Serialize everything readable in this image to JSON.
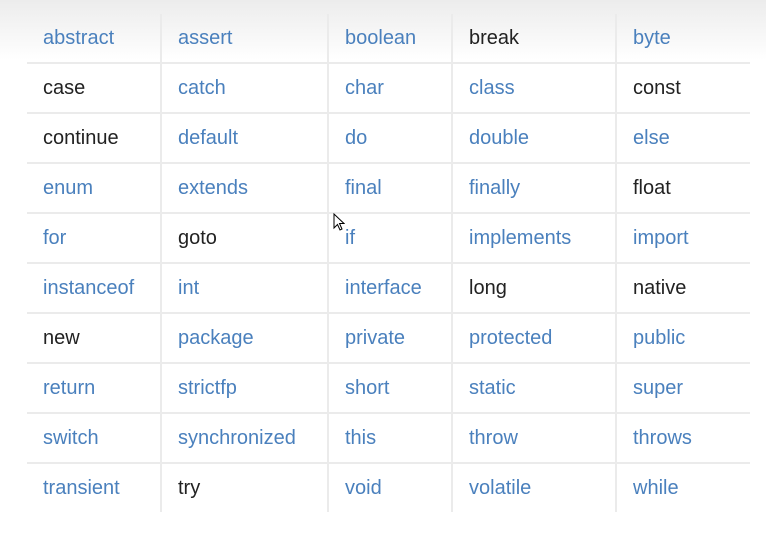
{
  "table": {
    "rows": [
      [
        {
          "t": "abstract",
          "link": true
        },
        {
          "t": "assert",
          "link": true
        },
        {
          "t": "boolean",
          "link": true
        },
        {
          "t": "break",
          "link": false
        },
        {
          "t": "byte",
          "link": true
        }
      ],
      [
        {
          "t": "case",
          "link": false
        },
        {
          "t": "catch",
          "link": true
        },
        {
          "t": "char",
          "link": true
        },
        {
          "t": "class",
          "link": true
        },
        {
          "t": "const",
          "link": false
        }
      ],
      [
        {
          "t": "continue",
          "link": false
        },
        {
          "t": "default",
          "link": true
        },
        {
          "t": "do",
          "link": true
        },
        {
          "t": "double",
          "link": true
        },
        {
          "t": "else",
          "link": true
        }
      ],
      [
        {
          "t": "enum",
          "link": true
        },
        {
          "t": "extends",
          "link": true
        },
        {
          "t": "final",
          "link": true
        },
        {
          "t": "finally",
          "link": true
        },
        {
          "t": "float",
          "link": false
        }
      ],
      [
        {
          "t": "for",
          "link": true
        },
        {
          "t": "goto",
          "link": false
        },
        {
          "t": "if",
          "link": true
        },
        {
          "t": "implements",
          "link": true
        },
        {
          "t": "import",
          "link": true
        }
      ],
      [
        {
          "t": "instanceof",
          "link": true
        },
        {
          "t": "int",
          "link": true
        },
        {
          "t": "interface",
          "link": true
        },
        {
          "t": "long",
          "link": false
        },
        {
          "t": "native",
          "link": false
        }
      ],
      [
        {
          "t": "new",
          "link": false
        },
        {
          "t": "package",
          "link": true
        },
        {
          "t": "private",
          "link": true
        },
        {
          "t": "protected",
          "link": true
        },
        {
          "t": "public",
          "link": true
        }
      ],
      [
        {
          "t": "return",
          "link": true
        },
        {
          "t": "strictfp",
          "link": true
        },
        {
          "t": "short",
          "link": true
        },
        {
          "t": "static",
          "link": true
        },
        {
          "t": "super",
          "link": true
        }
      ],
      [
        {
          "t": "switch",
          "link": true
        },
        {
          "t": "synchronized",
          "link": true
        },
        {
          "t": "this",
          "link": true
        },
        {
          "t": "throw",
          "link": true
        },
        {
          "t": "throws",
          "link": true
        }
      ],
      [
        {
          "t": "transient",
          "link": true
        },
        {
          "t": "try",
          "link": false
        },
        {
          "t": "void",
          "link": true
        },
        {
          "t": "volatile",
          "link": true
        },
        {
          "t": "while",
          "link": true
        }
      ]
    ]
  },
  "colors": {
    "link": "#4a80bd",
    "text": "#222222"
  },
  "cursor_icon": "mouse-pointer-icon"
}
